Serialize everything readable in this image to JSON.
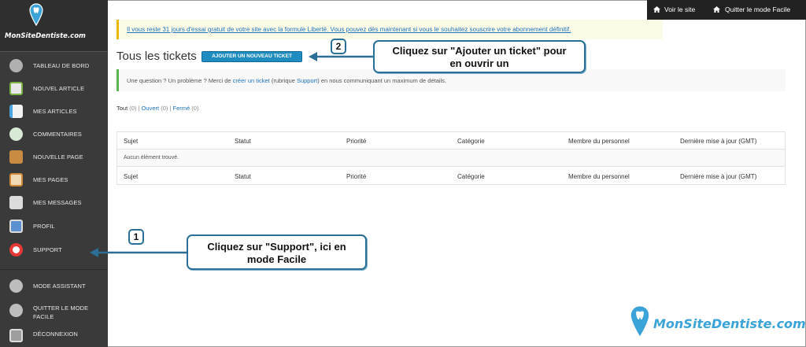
{
  "sidebar": {
    "logo_text": "MonSiteDentiste.com",
    "items": [
      {
        "label": "TABLEAU DE BORD",
        "icon": "dashboard-icon",
        "color": "#b0b0b0"
      },
      {
        "label": "NOUVEL ARTICLE",
        "icon": "new-article-icon",
        "color": "#7cb342"
      },
      {
        "label": "MES ARTICLES",
        "icon": "articles-icon",
        "color": "#4aa3df"
      },
      {
        "label": "COMMENTAIRES",
        "icon": "comments-icon",
        "color": "#a5d6a7"
      },
      {
        "label": "NOUVELLE PAGE",
        "icon": "new-page-icon",
        "color": "#d4a055"
      },
      {
        "label": "MES PAGES",
        "icon": "pages-icon",
        "color": "#e0a060"
      },
      {
        "label": "MES MESSAGES",
        "icon": "messages-icon",
        "color": "#c8c8c8"
      },
      {
        "label": "PROFIL",
        "icon": "profile-icon",
        "color": "#5a8fd0"
      },
      {
        "label": "SUPPORT",
        "icon": "support-icon",
        "color": "#e53935"
      },
      {
        "label": "MODE ASSISTANT",
        "icon": "assistant-icon",
        "color": "#bdbdbd"
      },
      {
        "label": "QUITTER LE MODE FACILE",
        "icon": "quit-easy-mode-icon",
        "color": "#bdbdbd"
      },
      {
        "label": "DÉCONNEXION",
        "icon": "logout-icon",
        "color": "#9e9e9e"
      }
    ]
  },
  "topbar": {
    "view_site": "Voir le site",
    "quit_easy": "Quitter le mode Facile"
  },
  "trial_notice": "Il vous reste 31 jours d'essai gratuit de votre site avec la formule Liberté. Vous pouvez dès maintenant si vous le souhaitez souscrire votre abonnement définitif.",
  "page": {
    "title": "Tous les tickets",
    "add_button": "AJOUTER UN NOUVEAU TICKET"
  },
  "info": {
    "before": "Une question ? Un problème ? Merci de ",
    "link1": "créer un ticket",
    "middle": " (rubrique ",
    "link2": "Support",
    "after": ") en nous communiquant un maximum de détails."
  },
  "filters": {
    "all": "Tout",
    "all_count": "(0)",
    "open": "Ouvert",
    "open_count": "(0)",
    "closed": "Fermé",
    "closed_count": "(0)",
    "sep": "|"
  },
  "table": {
    "columns": [
      "Sujet",
      "Statut",
      "Priorité",
      "Catégorie",
      "Membre du personnel",
      "Dernière mise à jour (GMT)"
    ],
    "empty": "Aucun élément trouvé."
  },
  "callouts": {
    "one_badge": "1",
    "one_line1": "Cliquez sur \"Support\", ici en",
    "one_line2": "mode Facile",
    "two_badge": "2",
    "two_line1": "Cliquez sur \"Ajouter un ticket\" pour",
    "two_line2": "en ouvrir un"
  },
  "brand": "MonSiteDentiste.com",
  "colors": {
    "accent": "#1e8cbe",
    "sidebar_bg": "#3a3a3a",
    "callout_border": "#2b6f96",
    "brand": "#3aa3d8"
  }
}
